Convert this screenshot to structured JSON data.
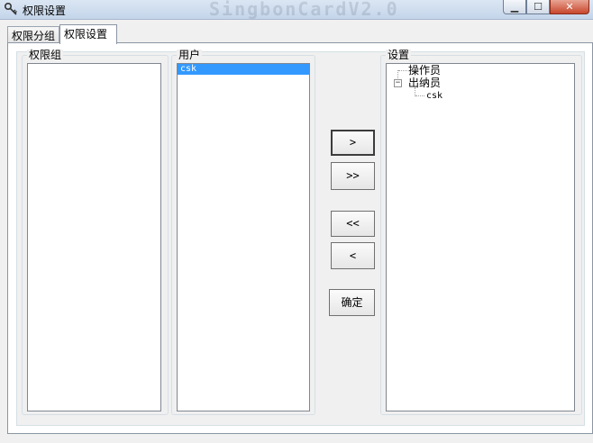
{
  "window": {
    "title": "权限设置",
    "ghost_title": "SingbonCardV2.0",
    "controls": {
      "minimize": "▁",
      "maximize": "☐",
      "close": "✕"
    }
  },
  "tabs": [
    {
      "label": "权限分组",
      "active": false
    },
    {
      "label": "权限设置",
      "active": true
    }
  ],
  "permission_group": {
    "label": "权限组",
    "items": []
  },
  "users": {
    "label": "用户",
    "items": [
      "csk"
    ],
    "selected": "csk"
  },
  "settings": {
    "label": "设置",
    "tree": [
      {
        "label": "操作员",
        "children": []
      },
      {
        "label": "出纳员",
        "expanded": true,
        "children": [
          {
            "label": "csk"
          }
        ]
      }
    ]
  },
  "buttons": {
    "add": ">",
    "add_all": ">>",
    "remove_all": "<<",
    "remove": "<",
    "ok": "确定"
  },
  "icons": {
    "app": "key-icon",
    "expander": "minus-icon"
  }
}
